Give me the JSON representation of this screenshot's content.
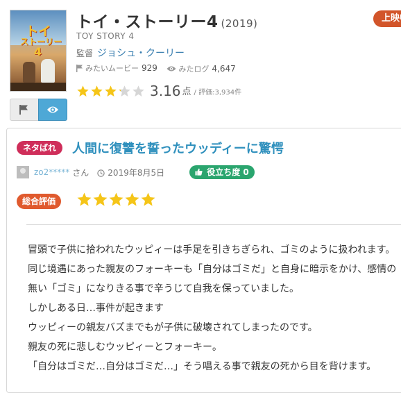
{
  "movie": {
    "poster_logo_line1": "トイ",
    "poster_logo_line2": "ストーリー",
    "poster_logo_num": "4",
    "title": "トイ・ストーリー4",
    "year": "(2019)",
    "showing_badge": "上映中",
    "english_title": "TOY STORY 4",
    "director_label": "監督",
    "director_name": "ジョシュ・クーリー",
    "want_label": "みたいムービー",
    "want_count": "929",
    "seen_label": "みたログ",
    "seen_count": "4,647",
    "rating_stars": 3.16,
    "score": "3.16",
    "score_unit": "点",
    "score_meta": "/ 評価:3,934件"
  },
  "buttons": {
    "want_icon": "flag-icon",
    "seen_icon": "eye-icon"
  },
  "review": {
    "spoiler_badge": "ネタばれ",
    "title": "人間に復讐を誓ったウッディーに驚愕",
    "username": "zo2*****",
    "user_suffix": "さん",
    "date": "2019年8月5日",
    "helpful_label": "役立ち度 0",
    "overall_label": "総合評価",
    "overall_stars": 5,
    "paragraphs": [
      "冒頭で子供に拾われたウッピィーは手足を引きちぎられ、ゴミのように扱われます。",
      "同じ境遇にあった親友のフォーキーも「自分はゴミだ」と自身に暗示をかけ、感情の",
      "無い「ゴミ」になりきる事で辛うじて自我を保っていました。",
      "しかしある日…事件が起きます",
      "ウッピィーの親友バズまでもが子供に破壊されてしまったのです。",
      "親友の死に悲しむウッピィーとフォーキー。",
      "「自分はゴミだ…自分はゴミだ…」そう唱える事で親友の死から目を背けます。"
    ]
  },
  "colors": {
    "star_filled": "#f5c518",
    "star_empty": "#d6d6d6",
    "link": "#2f90bd",
    "spoiler": "#cf2e5a",
    "overall": "#e05a2e",
    "helpful": "#2aa56e",
    "seen_button": "#4ea8d6"
  }
}
